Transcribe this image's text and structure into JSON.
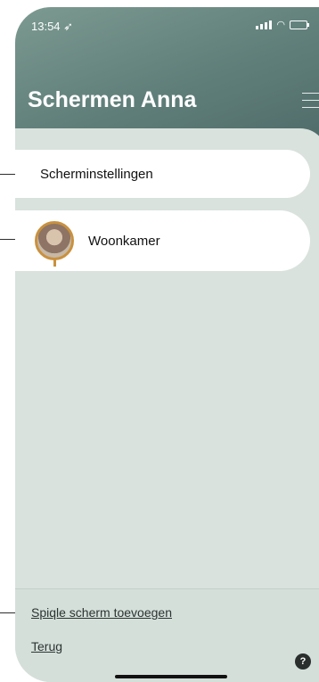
{
  "status": {
    "time": "13:54"
  },
  "header": {
    "title": "Schermen Anna"
  },
  "items": [
    {
      "label": "Scherminstellingen"
    },
    {
      "label": "Woonkamer"
    }
  ],
  "footer": {
    "add_mirror_label": "Spiqle scherm toevoegen",
    "back_label": "Terug",
    "help_label": "?"
  },
  "colors": {
    "header_gradient_start": "#7c9a91",
    "header_gradient_end": "#4f6a69",
    "content_bg": "#d9e2dd",
    "avatar_ring": "#c9913e"
  }
}
